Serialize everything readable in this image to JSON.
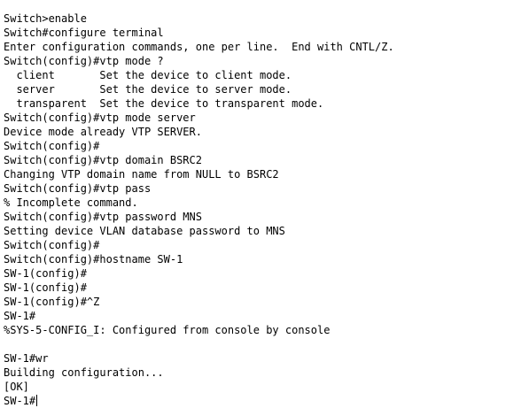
{
  "terminal": {
    "lines": [
      "Switch>enable",
      "Switch#configure terminal",
      "Enter configuration commands, one per line.  End with CNTL/Z.",
      "Switch(config)#vtp mode ?",
      "  client       Set the device to client mode.",
      "  server       Set the device to server mode.",
      "  transparent  Set the device to transparent mode.",
      "Switch(config)#vtp mode server",
      "Device mode already VTP SERVER.",
      "Switch(config)#",
      "Switch(config)#vtp domain BSRC2",
      "Changing VTP domain name from NULL to BSRC2",
      "Switch(config)#vtp pass",
      "% Incomplete command.",
      "Switch(config)#vtp password MNS",
      "Setting device VLAN database password to MNS",
      "Switch(config)#",
      "Switch(config)#hostname SW-1",
      "SW-1(config)#",
      "SW-1(config)#",
      "SW-1(config)#^Z",
      "SW-1#",
      "%SYS-5-CONFIG_I: Configured from console by console",
      "",
      "SW-1#wr",
      "Building configuration...",
      "[OK]",
      "SW-1#"
    ]
  }
}
